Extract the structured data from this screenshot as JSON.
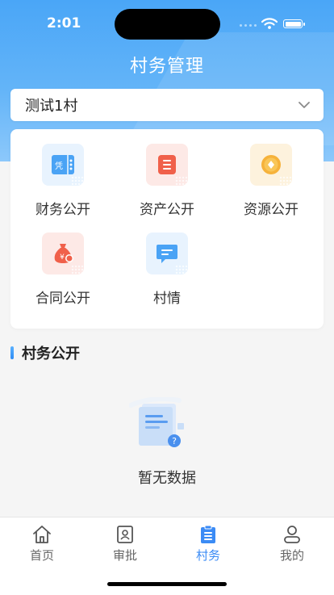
{
  "status": {
    "time": "2:01"
  },
  "header": {
    "title": "村务管理"
  },
  "village_select": {
    "value": "测试1村"
  },
  "menu": {
    "items": [
      {
        "label": "财务公开",
        "icon": "voucher-icon",
        "color": "#4aa3f5"
      },
      {
        "label": "资产公开",
        "icon": "document-list-icon",
        "color": "#f0604a"
      },
      {
        "label": "资源公开",
        "icon": "coin-icon",
        "color": "#f6b23a"
      },
      {
        "label": "合同公开",
        "icon": "money-bag-icon",
        "color": "#f0604a"
      },
      {
        "label": "村情",
        "icon": "chat-bubble-icon",
        "color": "#4aa3f5"
      }
    ]
  },
  "section": {
    "title": "村务公开"
  },
  "empty": {
    "text": "暂无数据"
  },
  "tabbar": {
    "items": [
      {
        "label": "首页",
        "icon": "home-icon",
        "active": false
      },
      {
        "label": "审批",
        "icon": "approval-icon",
        "active": false
      },
      {
        "label": "村务",
        "icon": "clipboard-icon",
        "active": true
      },
      {
        "label": "我的",
        "icon": "user-icon",
        "active": false
      }
    ]
  },
  "colors": {
    "primary": "#3b8bf5",
    "header_gradient_start": "#4aa6f7",
    "background": "#f5f5f5"
  }
}
